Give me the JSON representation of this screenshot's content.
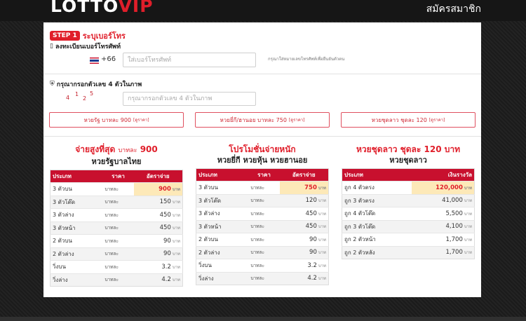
{
  "header": {
    "logo_part1": "LOTTO",
    "logo_part2": "VIP",
    "register_label": "สมัครสมาชิก"
  },
  "step": {
    "badge": "STEP 1",
    "title": "ระบุเบอร์โทร"
  },
  "phone": {
    "label": "ลงทะเบียนเบอร์โทรศัพท์",
    "country_code": "+66",
    "placeholder": "ใส่เบอร์โทรศัพท์",
    "hint": "กรุณาใส่หมายเลขโทรศัพท์เพื่อยืนยันตัวตน"
  },
  "captcha": {
    "label": "กรุณากรอกตัวเลข 4 ตัวในภาพ",
    "digits": [
      "4",
      "1",
      "2",
      "5"
    ],
    "placeholder": "กรุณากรอกตัวเลข 4 ตัวในภาพ"
  },
  "lottery_buttons": [
    {
      "label": "หวยรัฐ บาทละ 900",
      "detail": "[ดูราคา]"
    },
    {
      "label": "หวยยี่กี/ฮานอย บาทละ 750",
      "detail": "[ดูราคา]"
    },
    {
      "label": "หวยชุดลาว ชุดละ 120",
      "detail": "[ดูราคา]"
    }
  ],
  "columns": [
    {
      "title_main": "จ่ายสูงที่สุด",
      "title_small": "บาทละ",
      "title_value": "900",
      "subtitle": "หวยรัฐบาลไทย",
      "headers": [
        "ประเภท",
        "ราคา",
        "อัตราจ่าย"
      ],
      "rows": [
        {
          "type": "3 ตัวบน",
          "price": "บาทละ",
          "rate": "900",
          "unit": "บาท"
        },
        {
          "type": "3 ตัวโต๊ด",
          "price": "บาทละ",
          "rate": "150",
          "unit": "บาท"
        },
        {
          "type": "3 ตัวล่าง",
          "price": "บาทละ",
          "rate": "450",
          "unit": "บาท"
        },
        {
          "type": "3 ตัวหน้า",
          "price": "บาทละ",
          "rate": "450",
          "unit": "บาท"
        },
        {
          "type": "2 ตัวบน",
          "price": "บาทละ",
          "rate": "90",
          "unit": "บาท"
        },
        {
          "type": "2 ตัวล่าง",
          "price": "บาทละ",
          "rate": "90",
          "unit": "บาท"
        },
        {
          "type": "วิ่งบน",
          "price": "บาทละ",
          "rate": "3.2",
          "unit": "บาท"
        },
        {
          "type": "วิ่งล่าง",
          "price": "บาทละ",
          "rate": "4.2",
          "unit": "บาท"
        }
      ]
    },
    {
      "title_main": "โปรโมชั่นจ่ายหนัก",
      "subtitle": "หวยยี่กี หวยหุ้น หวยฮานอย",
      "headers": [
        "ประเภท",
        "ราคา",
        "อัตราจ่าย"
      ],
      "rows": [
        {
          "type": "3 ตัวบน",
          "price": "บาทละ",
          "rate": "750",
          "unit": "บาท"
        },
        {
          "type": "3 ตัวโต๊ด",
          "price": "บาทละ",
          "rate": "120",
          "unit": "บาท"
        },
        {
          "type": "3 ตัวล่าง",
          "price": "บาทละ",
          "rate": "450",
          "unit": "บาท"
        },
        {
          "type": "3 ตัวหน้า",
          "price": "บาทละ",
          "rate": "450",
          "unit": "บาท"
        },
        {
          "type": "2 ตัวบน",
          "price": "บาทละ",
          "rate": "90",
          "unit": "บาท"
        },
        {
          "type": "2 ตัวล่าง",
          "price": "บาทละ",
          "rate": "90",
          "unit": "บาท"
        },
        {
          "type": "วิ่งบน",
          "price": "บาทละ",
          "rate": "3.2",
          "unit": "บาท"
        },
        {
          "type": "วิ่งล่าง",
          "price": "บาทละ",
          "rate": "4.2",
          "unit": "บาท"
        }
      ]
    },
    {
      "title_main": "หวยชุดลาว ชุดละ 120 บาท",
      "subtitle": "หวยชุดลาว",
      "headers": [
        "ประเภท",
        "เงินรางวัล"
      ],
      "rows": [
        {
          "type": "ถูก 4 ตัวตรง",
          "rate": "120,000",
          "unit": "บาท"
        },
        {
          "type": "ถูก 3 ตัวตรง",
          "rate": "41,000",
          "unit": "บาท"
        },
        {
          "type": "ถูก 4 ตัวโต๊ด",
          "rate": "5,500",
          "unit": "บาท"
        },
        {
          "type": "ถูก 3 ตัวโต๊ด",
          "rate": "4,100",
          "unit": "บาท"
        },
        {
          "type": "ถูก 2 ตัวหน้า",
          "rate": "1,700",
          "unit": "บาท"
        },
        {
          "type": "ถูก 2 ตัวหลัง",
          "rate": "1,700",
          "unit": "บาท"
        }
      ]
    }
  ]
}
